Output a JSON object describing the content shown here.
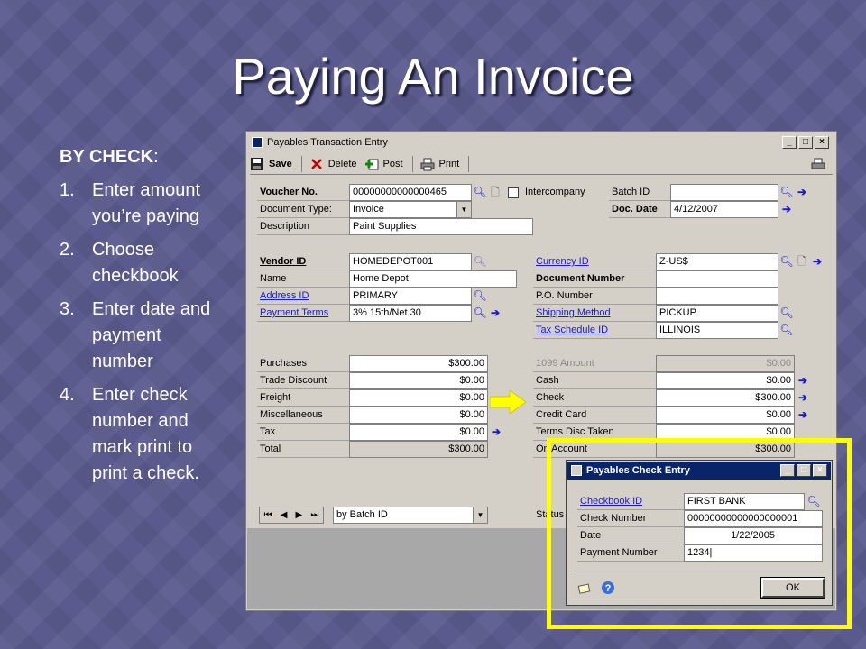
{
  "slide": {
    "title": "Paying An Invoice",
    "heading": "BY CHECK",
    "heading_colon": ":",
    "steps": [
      {
        "num": "1.",
        "text": "Enter amount you’re paying"
      },
      {
        "num": "2.",
        "text": "Choose checkbook"
      },
      {
        "num": "3.",
        "text": "Enter date and payment number"
      },
      {
        "num": "4.",
        "text": "Enter check number and mark print to print a check."
      }
    ]
  },
  "window": {
    "title": "Payables Transaction Entry",
    "controls": {
      "minimize": "_",
      "maximize": "□",
      "close": "×"
    },
    "toolbar": {
      "save": "Save",
      "delete": "Delete",
      "post": "Post",
      "print": "Print"
    },
    "header": {
      "voucher_no_label": "Voucher No.",
      "voucher_no_value": "00000000000000465",
      "intercompany_label": "Intercompany",
      "document_type_label": "Document Type:",
      "document_type_value": "Invoice",
      "description_label": "Description",
      "description_value": "Paint Supplies",
      "batch_id_label": "Batch ID",
      "batch_id_value": "",
      "doc_date_label": "Doc. Date",
      "doc_date_value": "4/12/2007"
    },
    "vendor": {
      "vendor_id_label": "Vendor ID",
      "vendor_id_value": "HOMEDEPOT001",
      "name_label": "Name",
      "name_value": "Home Depot",
      "address_id_label": "Address ID",
      "address_id_value": "PRIMARY",
      "payment_terms_label": "Payment Terms",
      "payment_terms_value": "3% 15th/Net 30",
      "currency_id_label": "Currency ID",
      "currency_id_value": "Z-US$",
      "document_number_label": "Document Number",
      "document_number_value": "",
      "po_number_label": "P.O. Number",
      "po_number_value": "",
      "shipping_method_label": "Shipping Method",
      "shipping_method_value": "PICKUP",
      "tax_schedule_label": "Tax Schedule ID",
      "tax_schedule_value": "ILLINOIS"
    },
    "amounts_left": [
      {
        "label": "Purchases",
        "value": "$300.00"
      },
      {
        "label": "Trade Discount",
        "value": "$0.00"
      },
      {
        "label": "Freight",
        "value": "$0.00"
      },
      {
        "label": "Miscellaneous",
        "value": "$0.00"
      },
      {
        "label": "Tax",
        "value": "$0.00"
      },
      {
        "label": "Total",
        "value": "$300.00"
      }
    ],
    "amounts_right": [
      {
        "label": "1099 Amount",
        "value": "$0.00"
      },
      {
        "label": "Cash",
        "value": "$0.00"
      },
      {
        "label": "Check",
        "value": "$300.00"
      },
      {
        "label": "Credit Card",
        "value": "$0.00"
      },
      {
        "label": "Terms Disc Taken",
        "value": "$0.00"
      },
      {
        "label": "On Account",
        "value": "$300.00"
      }
    ],
    "bottom": {
      "sort_value": "by Batch ID",
      "status_label": "Status"
    }
  },
  "dialog": {
    "title": "Payables Check Entry",
    "checkbook_id_label": "Checkbook ID",
    "checkbook_id_value": "FIRST BANK",
    "check_number_label": "Check Number",
    "check_number_value": "00000000000000000001",
    "date_label": "Date",
    "date_value": "1/22/2005",
    "payment_number_label": "Payment Number",
    "payment_number_value": "1234|",
    "ok_label": "OK"
  },
  "colors": {
    "highlight": "#ffff00",
    "link": "#1a1ad0",
    "dialog_title_bar": "#0a246a"
  }
}
